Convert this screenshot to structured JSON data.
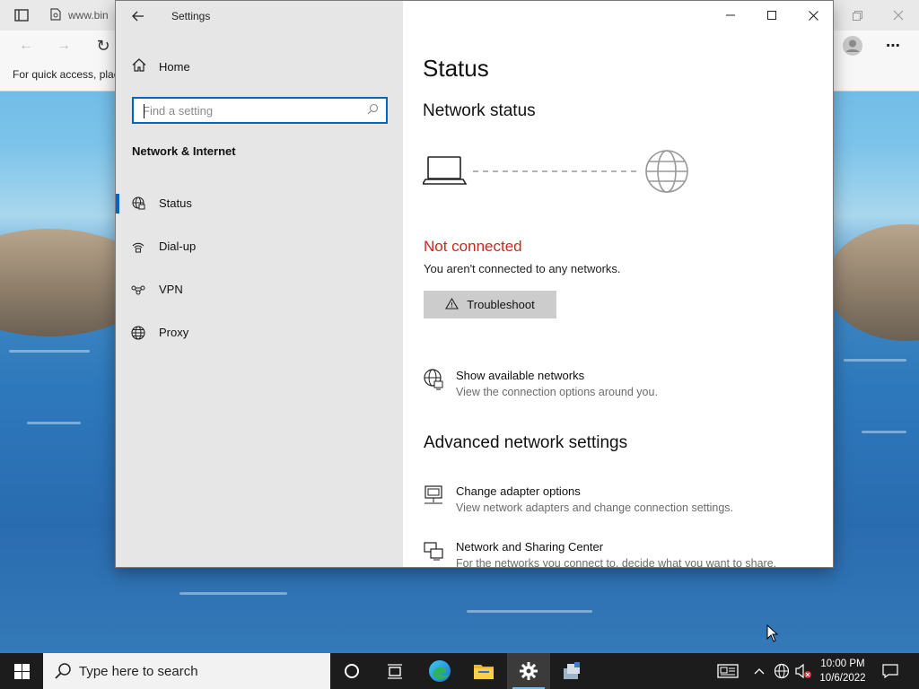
{
  "browser": {
    "tab_text": "www.bin",
    "favorites_text": "For quick access, plac",
    "icons": [
      "tab-actions-icon",
      "page-icon",
      "back-icon",
      "forward-icon",
      "refresh-icon",
      "restore-icon",
      "close-icon",
      "profile-icon",
      "more-icon"
    ]
  },
  "settings": {
    "title": "Settings",
    "window_controls": [
      "minimize",
      "maximize",
      "close"
    ],
    "sidebar": {
      "home_label": "Home",
      "search_placeholder": "Find a setting",
      "section_title": "Network & Internet",
      "items": [
        {
          "label": "Status",
          "icon": "network-status-icon",
          "selected": true
        },
        {
          "label": "Dial-up",
          "icon": "dialup-icon",
          "selected": false
        },
        {
          "label": "VPN",
          "icon": "vpn-icon",
          "selected": false
        },
        {
          "label": "Proxy",
          "icon": "globe-icon",
          "selected": false
        }
      ]
    },
    "main": {
      "title": "Status",
      "subtitle": "Network status",
      "connection_state": "Not connected",
      "connection_desc": "You aren't connected to any networks.",
      "troubleshoot_label": "Troubleshoot",
      "show_networks": {
        "title": "Show available networks",
        "desc": "View the connection options around you."
      },
      "advanced_title": "Advanced network settings",
      "adapter_options": {
        "title": "Change adapter options",
        "desc": "View network adapters and change connection settings."
      },
      "sharing_center": {
        "title": "Network and Sharing Center",
        "desc": "For the networks you connect to, decide what you want to share."
      }
    },
    "colors": {
      "accent": "#0067c0",
      "error": "#c42b1c",
      "sidebar_bg": "#e6e6e6"
    }
  },
  "taskbar": {
    "search_placeholder": "Type here to search",
    "apps": [
      "task-view",
      "edge",
      "file-explorer",
      "settings",
      "app"
    ],
    "active_app": "settings",
    "time": "10:00 PM",
    "date": "10/6/2022"
  }
}
